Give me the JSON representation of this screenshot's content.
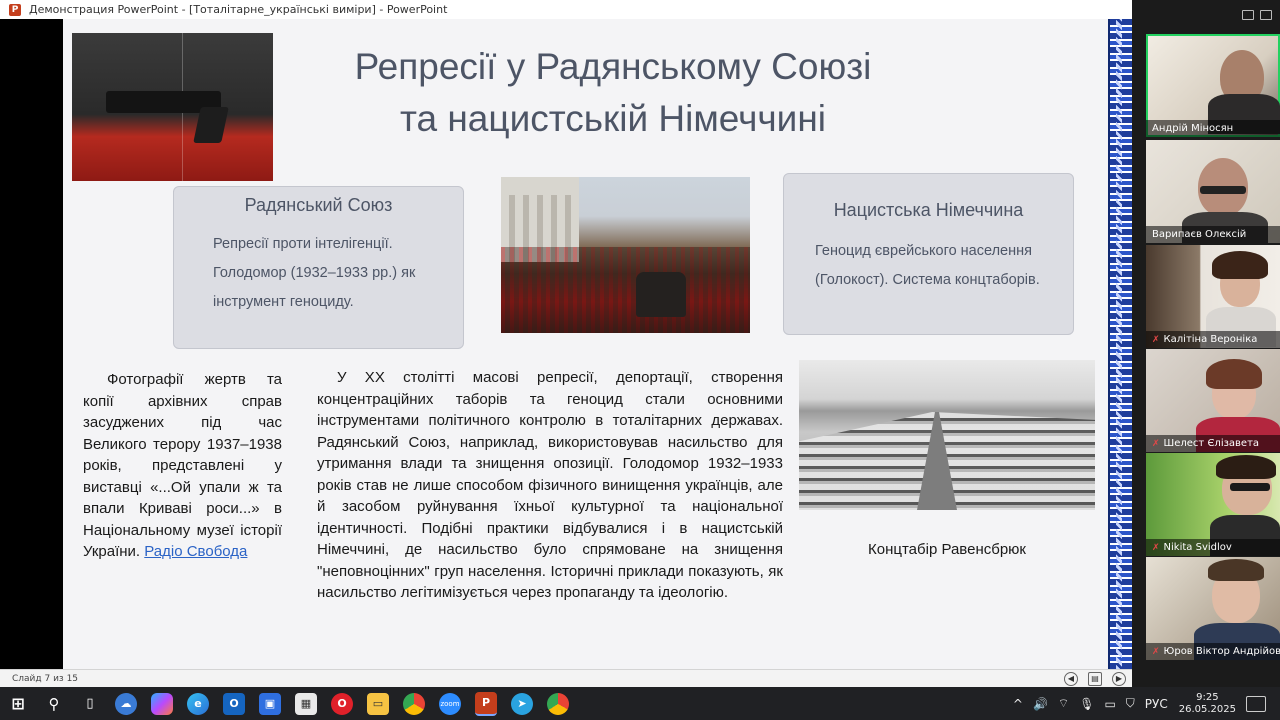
{
  "window": {
    "title": "Демонстрация PowerPoint - [Тоталітарне_українські виміри] - PowerPoint"
  },
  "slide": {
    "title_line1": "Репресії у Радянському Союзі",
    "title_line2": "та нацистській Німеччині",
    "card_left": {
      "title": "Радянський Союз",
      "text": "Репресії проти інтелігенції. Голодомор (1932–1933 рр.) як інструмент геноциду."
    },
    "card_right": {
      "title": "Нацистська Німеччина",
      "text": "Геноцид єврейського населення (Голокост). Система концтаборів."
    },
    "caption_left": {
      "text": "Фотографії жертв та копії архівних справ засуджених під час Великого терору 1937–1938 років, представлені у виставці «...Ой упали ж та впали Криваві роси...» в Національному музеї історії України. ",
      "link": "Радіо Свобода"
    },
    "main_text": "У XX столітті масові репресії, депортації, створення концентраційних таборів та геноцид стали основними інструментами політичного контролю в тоталітарних державах. Радянський Союз, наприклад, використовував насильство для утримання влади та знищення опозиції. Голодомор 1932–1933 років став не лише способом фізичного винищення українців, але й засобом руйнування їхньої культурної та національної ідентичності. Подібні практики відбувалися і в нацистській Німеччині, де насильство було спрямоване на знищення \"неповноцінних\" груп населення. Історичні приклади показують, як насильство легітимізується через пропаганду та ідеологію.",
    "camp_caption": "Концтабір Равенсбрюк"
  },
  "statusbar": {
    "slide_counter": "Слайд 7 из 15"
  },
  "participants": [
    {
      "name": "Андрій Міносян",
      "muted": false
    },
    {
      "name": "Варипаєв Олексій",
      "muted": false
    },
    {
      "name": "Калітіна Вероніка",
      "muted": true
    },
    {
      "name": "Шелест Єлізавета",
      "muted": true
    },
    {
      "name": "Nikita Svidlov",
      "muted": true
    },
    {
      "name": "Юров Віктор Андрійович",
      "muted": true
    }
  ],
  "taskbar": {
    "icons": [
      "windows-start",
      "search",
      "task-view",
      "widgets",
      "copilot",
      "edge",
      "outlook",
      "store-icon",
      "shop",
      "opera",
      "file-explorer",
      "chrome",
      "zoom",
      "powerpoint",
      "telegram",
      "chrome-alt"
    ],
    "zoom_label": "zoom",
    "language": "РУС",
    "time": "9:25",
    "date": "26.05.2025"
  }
}
